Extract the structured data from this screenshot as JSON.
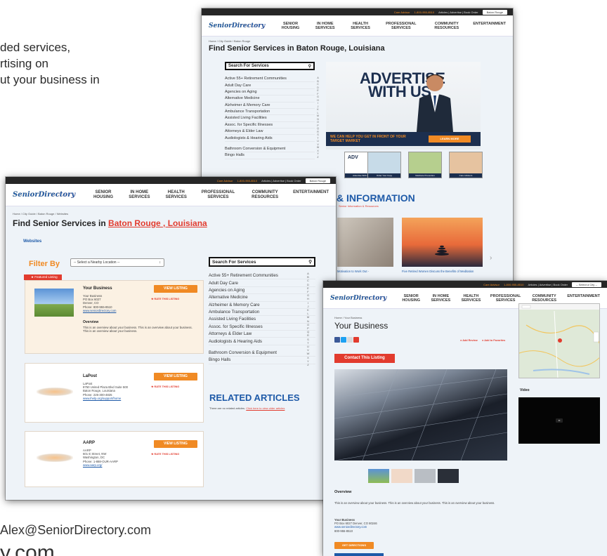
{
  "background": {
    "line1": "ded services,",
    "line2": "rtising on",
    "line3": "ut your business in",
    "email": "Alex@SeniorDirectory.com",
    "site": "y.com"
  },
  "site": {
    "logo": "SeniorDirectory",
    "care_advisor": "Care Advisor",
    "phone": "1-800-955-8510",
    "top_links": "Articles | Advertise | Book Order",
    "nav": [
      "SENIOR HOUSING",
      "IN HOME SERVICES",
      "HEALTH SERVICES",
      "PROFESSIONAL SERVICES",
      "COMMUNITY RESOURCES",
      "ENTERTAINMENT"
    ],
    "city_select": "Baton Rouge",
    "city_select_alt": "-- Select a City --"
  },
  "back_window": {
    "breadcrumb": "Home / City Guide / Baton Rouge",
    "title": "Find Senior Services in Baton Rouge, Louisiana",
    "search_label": "Search For Services",
    "services": [
      "Active 55+ Retirement Communities",
      "Adult Day Care",
      "Agencies on Aging",
      "Alternative Medicine",
      "Alzheimer & Memory Care",
      "Ambulance Transportation",
      "Assisted Living Facilities",
      "Assoc. for Specific Illnesses",
      "Attorneys & Elder Law",
      "Audiologists & Hearing Aids",
      "Bathroom Conversion & Equipment",
      "Bingo Halls"
    ],
    "alphabet": "ABCDEFGHIJKLMNOPQRSTUVWXYZ",
    "ad_line1": "ADVERTISE",
    "ad_line2": "WITH US",
    "ad_strip": "WE CAN HELP YOU GET IN FRONT OF YOUR TARGET MARKET",
    "ad_button": "LEARN MORE",
    "thumbs": [
      "Advertise With Us",
      "Order Your Copy",
      "Medicare Prevention",
      "Care Advisors"
    ],
    "section_title": "& INFORMATION",
    "section_sub": "Senior Information & Resources",
    "article1": "Motivation to Work Out -",
    "article2": "Five Retired Women Discuss the Benefits of Meditation"
  },
  "left_window": {
    "breadcrumb": "Home / City Guide / Baton Rouge / Websites",
    "title_prefix": "Find Senior Services in ",
    "title_city": "Baton Rouge , Louisiana",
    "subtitle": "Websites",
    "filter_label": "Filter By",
    "filter_select": "-- Select a Nearby Location --",
    "featured_tag": "Featured Listing",
    "view_listing": "VIEW LISTING",
    "rate_listing": "RATE THIS LISTING",
    "listings": [
      {
        "name": "Your Business",
        "lines": [
          "Your Business",
          "PO Box 6027",
          "Denver, CO",
          "Phone: 800-955-8510"
        ],
        "link": "www.seniordirectory.com",
        "overview_title": "Overview",
        "overview": "This is an overview about your business. This is an overview about your business. This is an overview about your business."
      },
      {
        "name": "LaPost",
        "lines": [
          "LaPost",
          "8750 United Plaza Blvd Suite 500",
          "Baton Rouge, Louisiana",
          "Phone: 225-300-4825"
        ],
        "link": "www.ihelp.org/support/home"
      },
      {
        "name": "AARP",
        "lines": [
          "AARP",
          "601 E Street, NW",
          "Washington, DC",
          "Phone: 1-888-OUR-AARP"
        ],
        "link": "www.aarp.org/"
      }
    ],
    "related_title": "RELATED ARTICLES",
    "related_text": "There are no related articles.",
    "related_link": "Click here to view older articles"
  },
  "right_window": {
    "breadcrumb": "Home / Your Business",
    "title": "Your Business",
    "contact_button": "Contact This Listing",
    "add_review": "Add Review",
    "add_favorite": "Add to Favorites",
    "video_label": "Video",
    "overview_title": "Overview",
    "overview": "This is an overview about your business. This is an overview about your business. This is an overview about your business.",
    "address": [
      "Your Business",
      "PO Box 6027 Denver, CO 80246",
      "www.seniordirectory.com",
      "800-955-8510"
    ],
    "directions_button": "GET DIRECTIONS"
  }
}
